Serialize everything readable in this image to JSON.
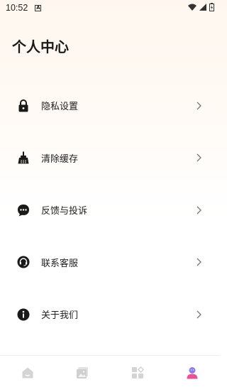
{
  "status_bar": {
    "time": "10:52",
    "indicator": "A",
    "icons": [
      "wifi-icon",
      "signal-icon",
      "battery-icon"
    ]
  },
  "header": {
    "title": "个人中心"
  },
  "menu": {
    "items": [
      {
        "label": "隐私设置",
        "icon": "lock-icon"
      },
      {
        "label": "清除缓存",
        "icon": "broom-icon"
      },
      {
        "label": "反馈与投诉",
        "icon": "chat-bubble-icon"
      },
      {
        "label": "联系客服",
        "icon": "headset-icon"
      },
      {
        "label": "关于我们",
        "icon": "info-icon"
      }
    ]
  },
  "bottom_nav": {
    "tabs": [
      {
        "icon": "home-icon",
        "active": false
      },
      {
        "icon": "gallery-icon",
        "active": false
      },
      {
        "icon": "apps-icon",
        "active": false
      },
      {
        "icon": "profile-icon",
        "active": true
      }
    ],
    "active_color": "#e8509a",
    "inactive_color": "#d0d0d0"
  }
}
